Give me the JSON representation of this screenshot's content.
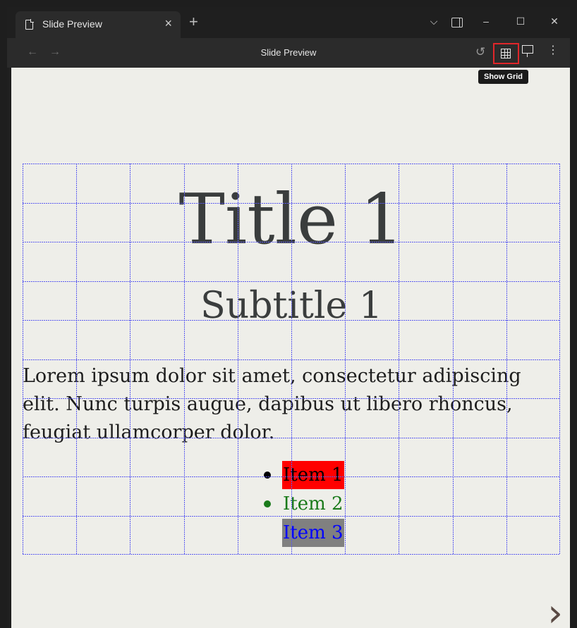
{
  "tab": {
    "title": "Slide Preview",
    "close": "×",
    "new_tab": "+"
  },
  "window_controls": {
    "dropdown": "⌵",
    "minimize": "–",
    "maximize": "☐",
    "close": "✕"
  },
  "toolbar": {
    "back": "←",
    "forward": "→",
    "title": "Slide Preview",
    "undo": "↺",
    "more": "⋮"
  },
  "tooltip": {
    "text": "Show Grid"
  },
  "slide": {
    "title": "Title 1",
    "subtitle": "Subtitle 1",
    "body": "Lorem ipsum dolor sit amet, consectetur adipiscing elit. Nunc turpis augue, dapibus ut libero rhoncus, feugiat ullamcorper dolor.",
    "items": [
      {
        "text": "Item 1",
        "color": "#000000",
        "bullet_color": "#000000",
        "highlight": "#ff0000"
      },
      {
        "text": "Item 2",
        "color": "#1a7a1a",
        "bullet_color": "#1a7a1a",
        "highlight": ""
      },
      {
        "text": "Item 3",
        "color": "#0000ff",
        "bullet_color": "",
        "highlight": "#808080"
      }
    ],
    "next": "›"
  },
  "colors": {
    "grid_line": "#5b5bf0",
    "grid_button_outline": "#e0262a",
    "slide_background": "#eeeee9"
  }
}
